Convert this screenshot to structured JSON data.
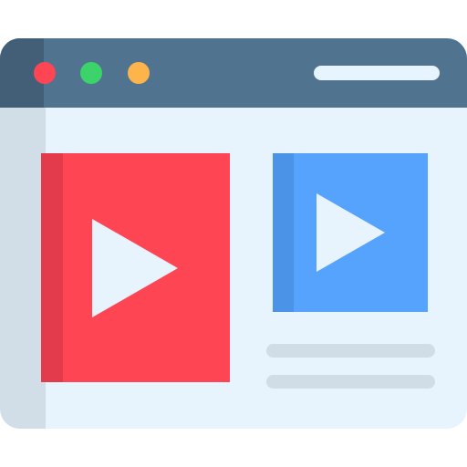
{
  "illustration": {
    "subject": "browser-window-with-video-players",
    "icons": {
      "window": "browser-window-icon",
      "play_large": "play-icon",
      "play_small": "play-icon"
    },
    "colors": {
      "window_body": "#e8f4fd",
      "window_shade": "#d1dde7",
      "title_bar": "#50748f",
      "title_bar_shade": "#435f78",
      "dot_close": "#fe4554",
      "dot_minimize": "#3bd36a",
      "dot_maximize": "#fdb44b",
      "address_bar": "#e8f4fd",
      "large_player": "#fe4554",
      "large_player_spine": "#e33a4c",
      "small_player": "#56a3fe",
      "small_player_spine": "#4b93e6",
      "play_triangle": "#e8f4fd",
      "text_lines": "#d0dce6"
    },
    "text_line_count": 2
  }
}
